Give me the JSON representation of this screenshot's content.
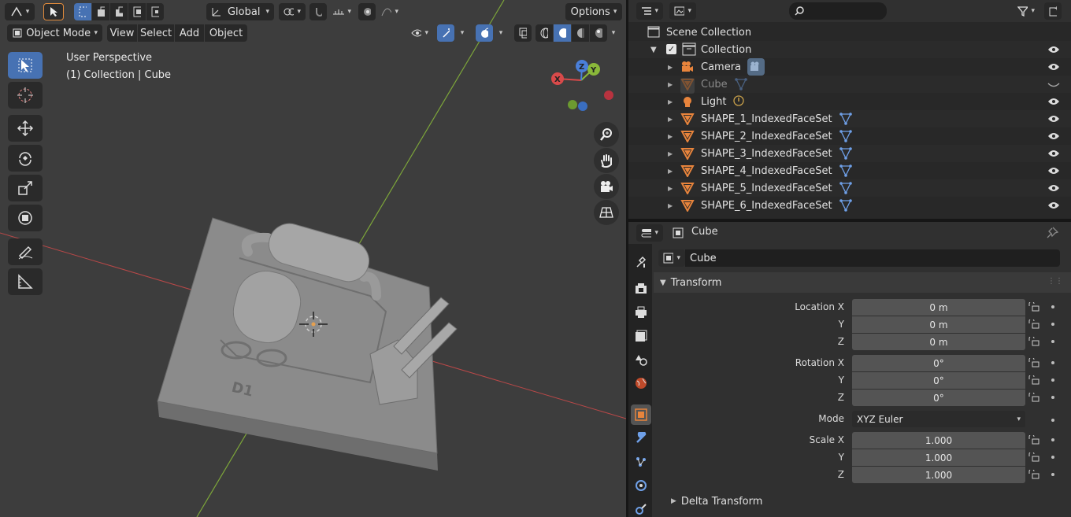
{
  "viewport": {
    "header": {
      "orientation": "Global",
      "options_label": "Options",
      "mode": "Object Mode",
      "menus": [
        "View",
        "Select",
        "Add",
        "Object"
      ]
    },
    "overlay": {
      "view_name": "User Perspective",
      "context": "(1) Collection | Cube"
    },
    "gizmo": {
      "x": "X",
      "y": "Y",
      "z": "Z"
    },
    "board_label": "D1",
    "colors": {
      "x_axis": "#d94a4a",
      "y_axis": "#8ab83a",
      "z_axis": "#4a7fd9",
      "accent": "#4772b3",
      "origin": "#e5a050"
    }
  },
  "outliner": {
    "search_placeholder": "",
    "scene_collection": "Scene Collection",
    "collection": "Collection",
    "items": [
      {
        "name": "Camera",
        "icon": "camera-icon",
        "dim": false
      },
      {
        "name": "Cube",
        "icon": "mesh-icon",
        "dim": true
      },
      {
        "name": "Light",
        "icon": "light-icon",
        "dim": false
      },
      {
        "name": "SHAPE_1_IndexedFaceSet",
        "icon": "mesh-icon",
        "dim": false
      },
      {
        "name": "SHAPE_2_IndexedFaceSet",
        "icon": "mesh-icon",
        "dim": false
      },
      {
        "name": "SHAPE_3_IndexedFaceSet",
        "icon": "mesh-icon",
        "dim": false
      },
      {
        "name": "SHAPE_4_IndexedFaceSet",
        "icon": "mesh-icon",
        "dim": false
      },
      {
        "name": "SHAPE_5_IndexedFaceSet",
        "icon": "mesh-icon",
        "dim": false
      },
      {
        "name": "SHAPE_6_IndexedFaceSet",
        "icon": "mesh-icon",
        "dim": false
      }
    ]
  },
  "properties": {
    "header_object": "Cube",
    "object_name": "Cube",
    "transform_label": "Transform",
    "location": {
      "label_x": "Location X",
      "label_y": "Y",
      "label_z": "Z",
      "x": "0 m",
      "y": "0 m",
      "z": "0 m"
    },
    "rotation": {
      "label_x": "Rotation X",
      "label_y": "Y",
      "label_z": "Z",
      "x": "0°",
      "y": "0°",
      "z": "0°"
    },
    "mode": {
      "label": "Mode",
      "value": "XYZ Euler"
    },
    "scale": {
      "label_x": "Scale X",
      "label_y": "Y",
      "label_z": "Z",
      "x": "1.000",
      "y": "1.000",
      "z": "1.000"
    },
    "delta_transform_label": "Delta Transform"
  }
}
